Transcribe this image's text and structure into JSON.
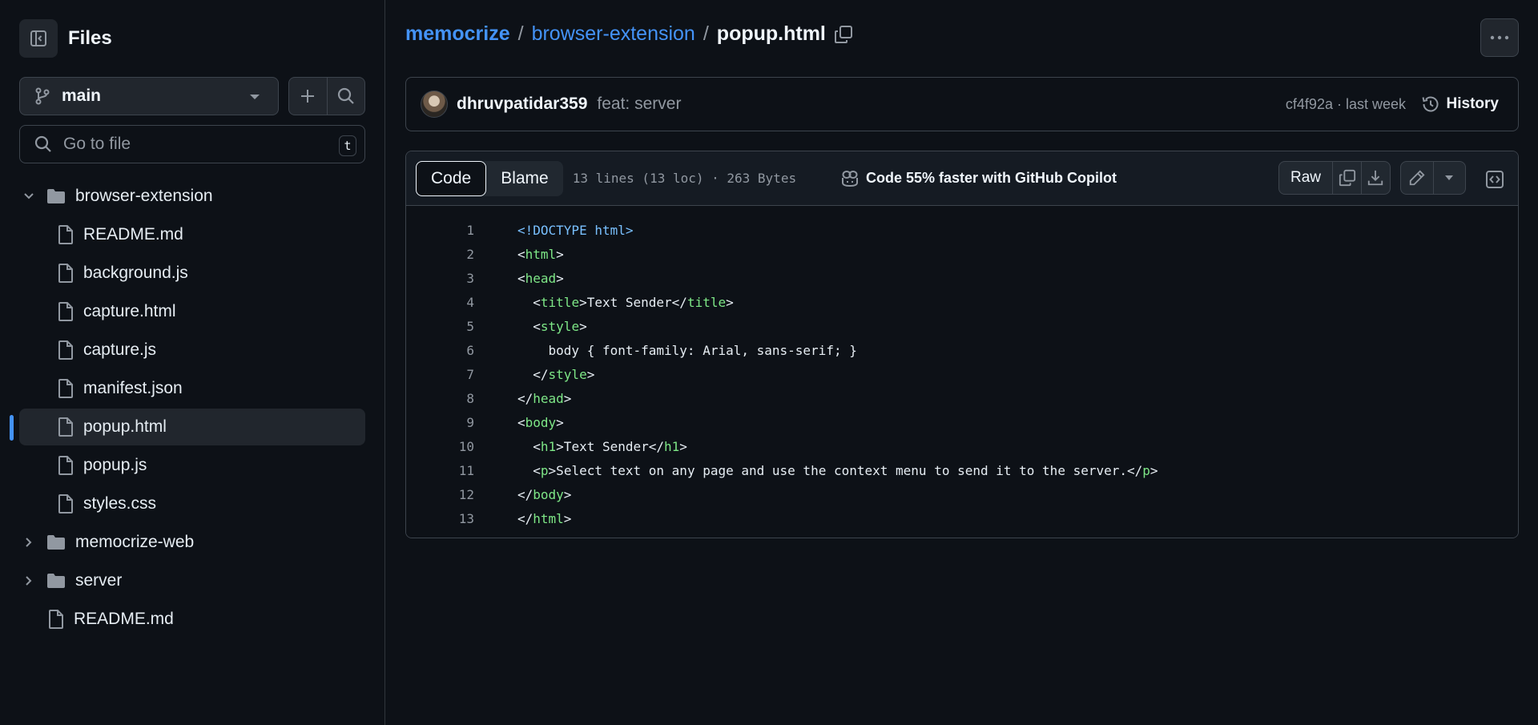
{
  "sidebar": {
    "title": "Files",
    "branch": "main",
    "search_placeholder": "Go to file",
    "shortcut": "t",
    "tree": [
      {
        "label": "browser-extension",
        "type": "folder",
        "expanded": true,
        "depth": 0
      },
      {
        "label": "README.md",
        "type": "file",
        "depth": 1
      },
      {
        "label": "background.js",
        "type": "file",
        "depth": 1
      },
      {
        "label": "capture.html",
        "type": "file",
        "depth": 1
      },
      {
        "label": "capture.js",
        "type": "file",
        "depth": 1
      },
      {
        "label": "manifest.json",
        "type": "file",
        "depth": 1
      },
      {
        "label": "popup.html",
        "type": "file",
        "depth": 1,
        "selected": true
      },
      {
        "label": "popup.js",
        "type": "file",
        "depth": 1
      },
      {
        "label": "styles.css",
        "type": "file",
        "depth": 1
      },
      {
        "label": "memocrize-web",
        "type": "folder",
        "expanded": false,
        "depth": 0
      },
      {
        "label": "server",
        "type": "folder",
        "expanded": false,
        "depth": 0
      },
      {
        "label": "README.md",
        "type": "file",
        "depth": 0
      }
    ]
  },
  "breadcrumb": {
    "owner": "memocrize",
    "repo": "browser-extension",
    "separator": "/",
    "file": "popup.html"
  },
  "commit": {
    "author": "dhruvpatidar359",
    "message": "feat: server",
    "meta": "cf4f92a · last week",
    "history_label": "History"
  },
  "code_toolbar": {
    "tab_code": "Code",
    "tab_blame": "Blame",
    "file_info": "13 lines (13 loc) · 263 Bytes",
    "copilot": "Code 55% faster with GitHub Copilot",
    "raw_label": "Raw"
  },
  "code_lines": [
    [
      {
        "t": "<!DOCTYPE html>",
        "c": "doc"
      }
    ],
    [
      {
        "t": "<"
      },
      {
        "t": "html",
        "c": "tag"
      },
      {
        "t": ">"
      }
    ],
    [
      {
        "t": "<"
      },
      {
        "t": "head",
        "c": "tag"
      },
      {
        "t": ">"
      }
    ],
    [
      {
        "t": "  <"
      },
      {
        "t": "title",
        "c": "tag"
      },
      {
        "t": ">Text Sender</"
      },
      {
        "t": "title",
        "c": "tag"
      },
      {
        "t": ">"
      }
    ],
    [
      {
        "t": "  <"
      },
      {
        "t": "style",
        "c": "tag"
      },
      {
        "t": ">"
      }
    ],
    [
      {
        "t": "    body { font-family: Arial, sans-serif; }"
      }
    ],
    [
      {
        "t": "  </"
      },
      {
        "t": "style",
        "c": "tag"
      },
      {
        "t": ">"
      }
    ],
    [
      {
        "t": "</"
      },
      {
        "t": "head",
        "c": "tag"
      },
      {
        "t": ">"
      }
    ],
    [
      {
        "t": "<"
      },
      {
        "t": "body",
        "c": "tag"
      },
      {
        "t": ">"
      }
    ],
    [
      {
        "t": "  <"
      },
      {
        "t": "h1",
        "c": "tag"
      },
      {
        "t": ">Text Sender</"
      },
      {
        "t": "h1",
        "c": "tag"
      },
      {
        "t": ">"
      }
    ],
    [
      {
        "t": "  <"
      },
      {
        "t": "p",
        "c": "tag"
      },
      {
        "t": ">Select text on any page and use the context menu to send it to the server.</"
      },
      {
        "t": "p",
        "c": "tag"
      },
      {
        "t": ">"
      }
    ],
    [
      {
        "t": "</"
      },
      {
        "t": "body",
        "c": "tag"
      },
      {
        "t": ">"
      }
    ],
    [
      {
        "t": "</"
      },
      {
        "t": "html",
        "c": "tag"
      },
      {
        "t": ">"
      }
    ]
  ],
  "colors": {
    "background": "#0d1117",
    "accent": "#4493f8",
    "tag": "#7ee787",
    "doctype": "#79c0ff"
  }
}
